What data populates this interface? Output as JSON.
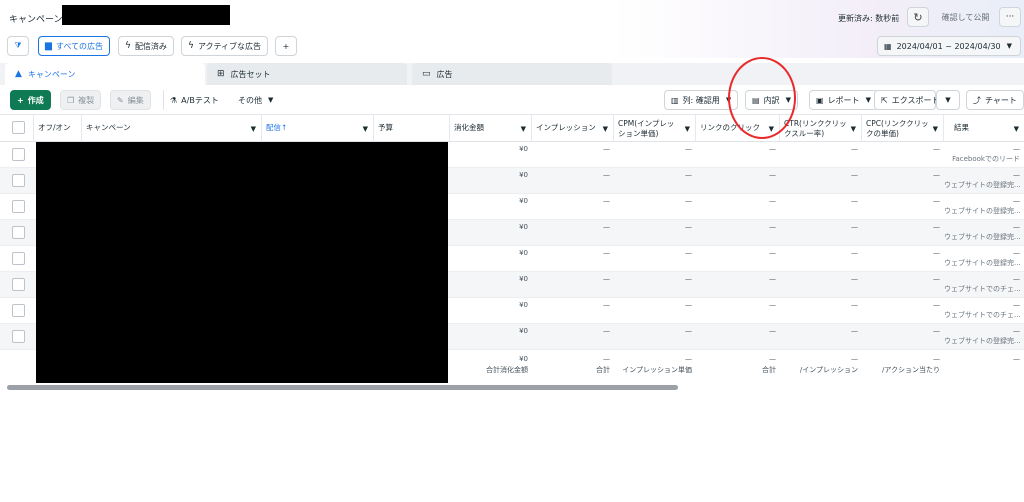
{
  "header": {
    "title": "キャンペーン",
    "status": "更新済み: 数秒前",
    "publish_label": "確認して公開",
    "more_label": "···"
  },
  "filters": {
    "all_ads": "すべての広告",
    "delivered": "配信済み",
    "active_ads": "アクティブな広告",
    "add": "+"
  },
  "date_range": "2024/04/01 ~ 2024/04/30",
  "tabs": [
    {
      "label": "キャンペーン"
    },
    {
      "label": "広告セット"
    },
    {
      "label": "広告"
    }
  ],
  "toolbar": {
    "create": "作成",
    "duplicate": "複製",
    "edit": "編集",
    "ab_test": "A/Bテスト",
    "other": "その他",
    "columns": "列: 確認用",
    "breakdown": "内訳",
    "reports": "レポート",
    "export": "エクスポート",
    "chart": "チャート"
  },
  "columns": [
    {
      "label": "オフ/オン"
    },
    {
      "label": "キャンペーン"
    },
    {
      "label": "配信↑"
    },
    {
      "label": "予算"
    },
    {
      "label": "消化金額"
    },
    {
      "label": "インプレッション"
    },
    {
      "label": "CPM(インプレッション単価)"
    },
    {
      "label": "リンクのクリック"
    },
    {
      "label": "CTR(リンククリックスルー率)"
    },
    {
      "label": "CPC(リンククリックの単価)"
    },
    {
      "label": "結果"
    }
  ],
  "rows": [
    {
      "spend": "¥0",
      "result": "Facebookでのリード"
    },
    {
      "spend": "¥0",
      "result": "ウェブサイトの登録完..."
    },
    {
      "spend": "¥0",
      "result": "ウェブサイトの登録完..."
    },
    {
      "spend": "¥0",
      "result": "ウェブサイトの登録完..."
    },
    {
      "spend": "¥0",
      "result": "ウェブサイトの登録完..."
    },
    {
      "spend": "¥0",
      "result": "ウェブサイトでのチェ..."
    },
    {
      "spend": "¥0",
      "result": "ウェブサイトでのチェ..."
    },
    {
      "spend": "¥0",
      "result": "ウェブサイトの登録完..."
    }
  ],
  "dash": "—",
  "summary": {
    "spend_value": "¥0",
    "spend_label": "合計消化金額",
    "impressions_label": "合計",
    "cpm_label": "インプレッション単価",
    "clicks_label": "合計",
    "ctr_label": "/インプレッション",
    "cpc_label": "/アクション当たり"
  }
}
